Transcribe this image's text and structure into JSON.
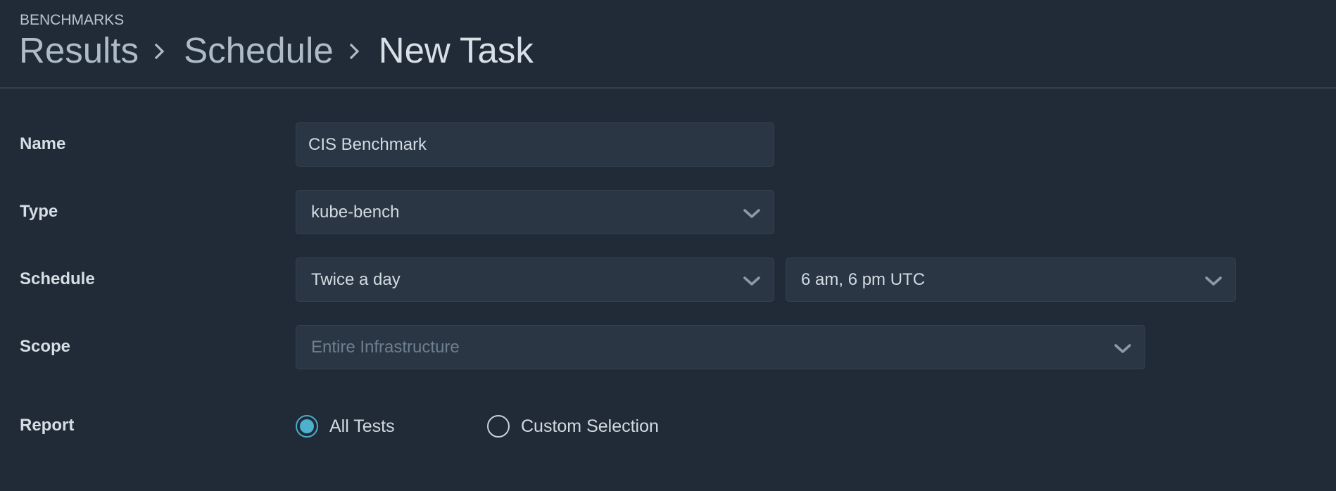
{
  "header": {
    "section": "BENCHMARKS",
    "breadcrumb": [
      {
        "label": "Results"
      },
      {
        "label": "Schedule"
      },
      {
        "label": "New Task"
      }
    ]
  },
  "form": {
    "name": {
      "label": "Name",
      "value": "CIS Benchmark"
    },
    "type": {
      "label": "Type",
      "value": "kube-bench"
    },
    "schedule": {
      "label": "Schedule",
      "frequency": "Twice a day",
      "times": "6 am, 6 pm UTC"
    },
    "scope": {
      "label": "Scope",
      "placeholder": "Entire Infrastructure"
    },
    "report": {
      "label": "Report",
      "options": [
        {
          "label": "All Tests",
          "checked": true
        },
        {
          "label": "Custom Selection",
          "checked": false
        }
      ]
    }
  },
  "icons": {
    "breadcrumb_separator": "chevron-right-icon",
    "dropdown": "chevron-down-icon"
  },
  "colors": {
    "background": "#212b38",
    "field_background": "#2a3644",
    "accent": "#4aabc9"
  }
}
